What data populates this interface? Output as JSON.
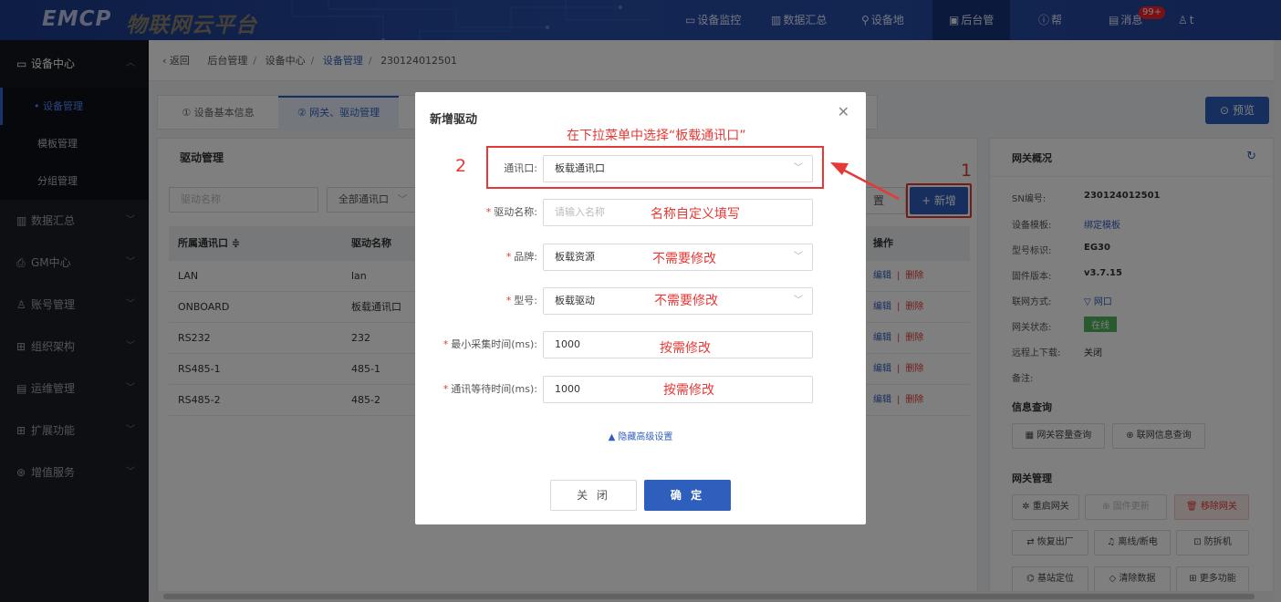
{
  "header": {
    "logo_text": "EMCP",
    "logo_subtitle": "物联网云平台",
    "nav": [
      {
        "label": "设备监控",
        "icon": "monitor-icon"
      },
      {
        "label": "数据汇总",
        "icon": "chart-icon"
      },
      {
        "label": "设备地",
        "icon": "pin-icon"
      },
      {
        "label": "后台管",
        "icon": "desktop-icon",
        "active": true
      },
      {
        "label": "帮",
        "icon": "help-icon"
      },
      {
        "label": "消息",
        "icon": "message-icon",
        "badge": "99+"
      },
      {
        "label": "t",
        "icon": "user-icon"
      }
    ]
  },
  "sidebar": {
    "group": "设备中心",
    "sub_items": [
      "设备管理",
      "模板管理",
      "分组管理"
    ],
    "items": [
      "数据汇总",
      "GM中心",
      "账号管理",
      "组织架构",
      "运维管理",
      "扩展功能",
      "增值服务"
    ]
  },
  "breadcrumb": {
    "back": "返回",
    "path": [
      "后台管理",
      "设备中心",
      "设备管理",
      "230124012501"
    ]
  },
  "tabs": [
    "① 设备基本信息",
    "② 网关、驱动管理"
  ],
  "preview_label": "预览",
  "driver_panel": {
    "title": "驱动管理",
    "name_placeholder": "驱动名称",
    "port_filter": "全部通讯口",
    "reset_label": "置",
    "add_label": "+ 新增",
    "columns": [
      "所属通讯口 ≑",
      "驱动名称",
      "操作"
    ],
    "rows": [
      {
        "port": "LAN",
        "name": "lan"
      },
      {
        "port": "ONBOARD",
        "name": "板载通讯口"
      },
      {
        "port": "RS232",
        "name": "232"
      },
      {
        "port": "RS485-1",
        "name": "485-1"
      },
      {
        "port": "RS485-2",
        "name": "485-2"
      }
    ],
    "edit_label": "编辑",
    "delete_label": "删除"
  },
  "gateway": {
    "title": "网关概况",
    "fields": [
      {
        "label": "SN编号:",
        "value": "230124012501"
      },
      {
        "label": "设备模板:",
        "value": "绑定模板",
        "link": true
      },
      {
        "label": "型号标识:",
        "value": "EG30"
      },
      {
        "label": "固件版本:",
        "value": "v3.7.15"
      },
      {
        "label": "联网方式:",
        "value": "网口",
        "link": true
      },
      {
        "label": "网关状态:",
        "value": "在线"
      },
      {
        "label": "远程上下载:",
        "value": "关闭"
      },
      {
        "label": "备注:",
        "value": ""
      }
    ],
    "info_section": "信息查询",
    "info_buttons": [
      "网关容量查询",
      "联网信息查询"
    ],
    "mgmt_section": "网关管理",
    "mgmt_buttons": [
      "重启网关",
      "固件更新",
      "移除网关",
      "恢复出厂",
      "离线/断电",
      "防拆机",
      "基站定位",
      "清除数据",
      "更多功能"
    ]
  },
  "modal": {
    "title": "新增驱动",
    "fields": [
      {
        "label": "通讯口:",
        "value": "板载通讯口",
        "required": false
      },
      {
        "label": "驱动名称:",
        "placeholder": "请输入名称",
        "required": true
      },
      {
        "label": "品牌:",
        "value": "板载资源",
        "required": true
      },
      {
        "label": "型号:",
        "value": "板载驱动",
        "required": true
      },
      {
        "label": "最小采集时间(ms):",
        "value": "1000",
        "required": true
      },
      {
        "label": "通讯等待时间(ms):",
        "value": "1000",
        "required": true
      }
    ],
    "advanced_toggle": "▲ 隐藏高级设置",
    "cancel_label": "关 闭",
    "ok_label": "确 定"
  },
  "annotations": {
    "step1": "1",
    "step2": "2",
    "hint_port": "在下拉菜单中选择“板载通讯口”",
    "hint_name": "名称自定义填写",
    "hint_brand": "不需要修改",
    "hint_model": "不需要修改",
    "hint_min_time": "按需修改",
    "hint_wait_time": "按需修改"
  }
}
